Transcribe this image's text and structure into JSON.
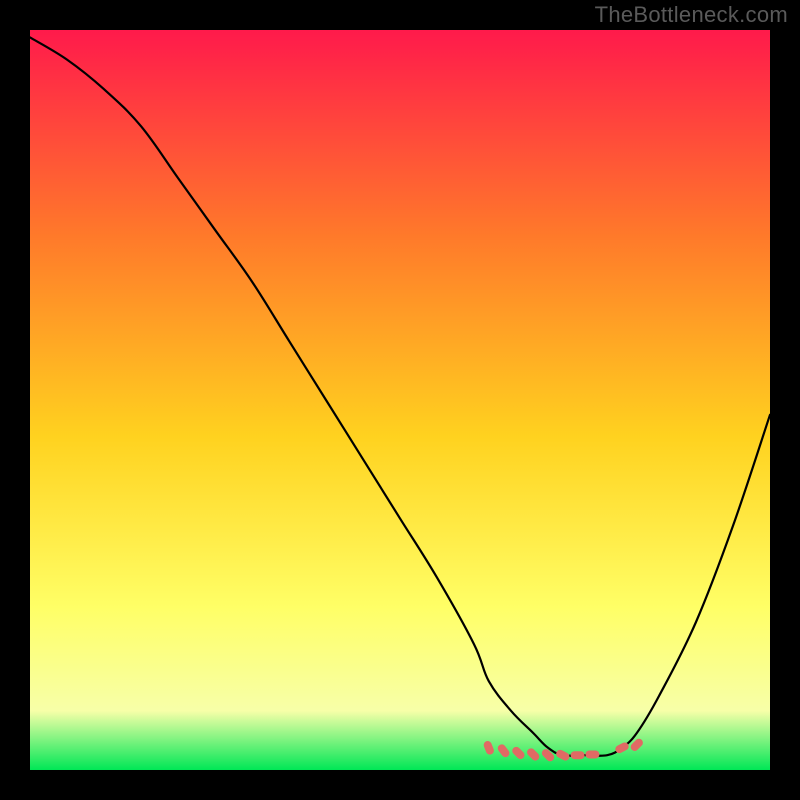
{
  "watermark": "TheBottleneck.com",
  "chart_data": {
    "type": "line",
    "title": "",
    "xlabel": "",
    "ylabel": "",
    "xlim": [
      0,
      100
    ],
    "ylim": [
      0,
      100
    ],
    "grid": false,
    "legend": false,
    "gradient_colors": {
      "top": "#ff1a4b",
      "upper_mid": "#ff7a2a",
      "mid": "#ffd21f",
      "lower_mid": "#ffff66",
      "lower": "#f7ffa8",
      "bottom": "#00e756"
    },
    "series": [
      {
        "name": "bottleneck-curve",
        "color": "#000000",
        "x": [
          0,
          5,
          10,
          15,
          20,
          25,
          30,
          35,
          40,
          45,
          50,
          55,
          60,
          62,
          65,
          68,
          70,
          72,
          75,
          78,
          80,
          82,
          85,
          90,
          95,
          100
        ],
        "y": [
          99,
          96,
          92,
          87,
          80,
          73,
          66,
          58,
          50,
          42,
          34,
          26,
          17,
          12,
          8,
          5,
          3,
          2,
          2,
          2,
          3,
          5,
          10,
          20,
          33,
          48
        ]
      },
      {
        "name": "optimum-band-markers",
        "type": "scatter",
        "color": "#e06a64",
        "x": [
          62,
          64,
          66,
          68,
          70,
          72,
          74,
          76,
          80,
          82
        ],
        "y": [
          3.0,
          2.6,
          2.3,
          2.1,
          2.0,
          2.0,
          2.0,
          2.1,
          3.0,
          3.4
        ]
      }
    ]
  }
}
